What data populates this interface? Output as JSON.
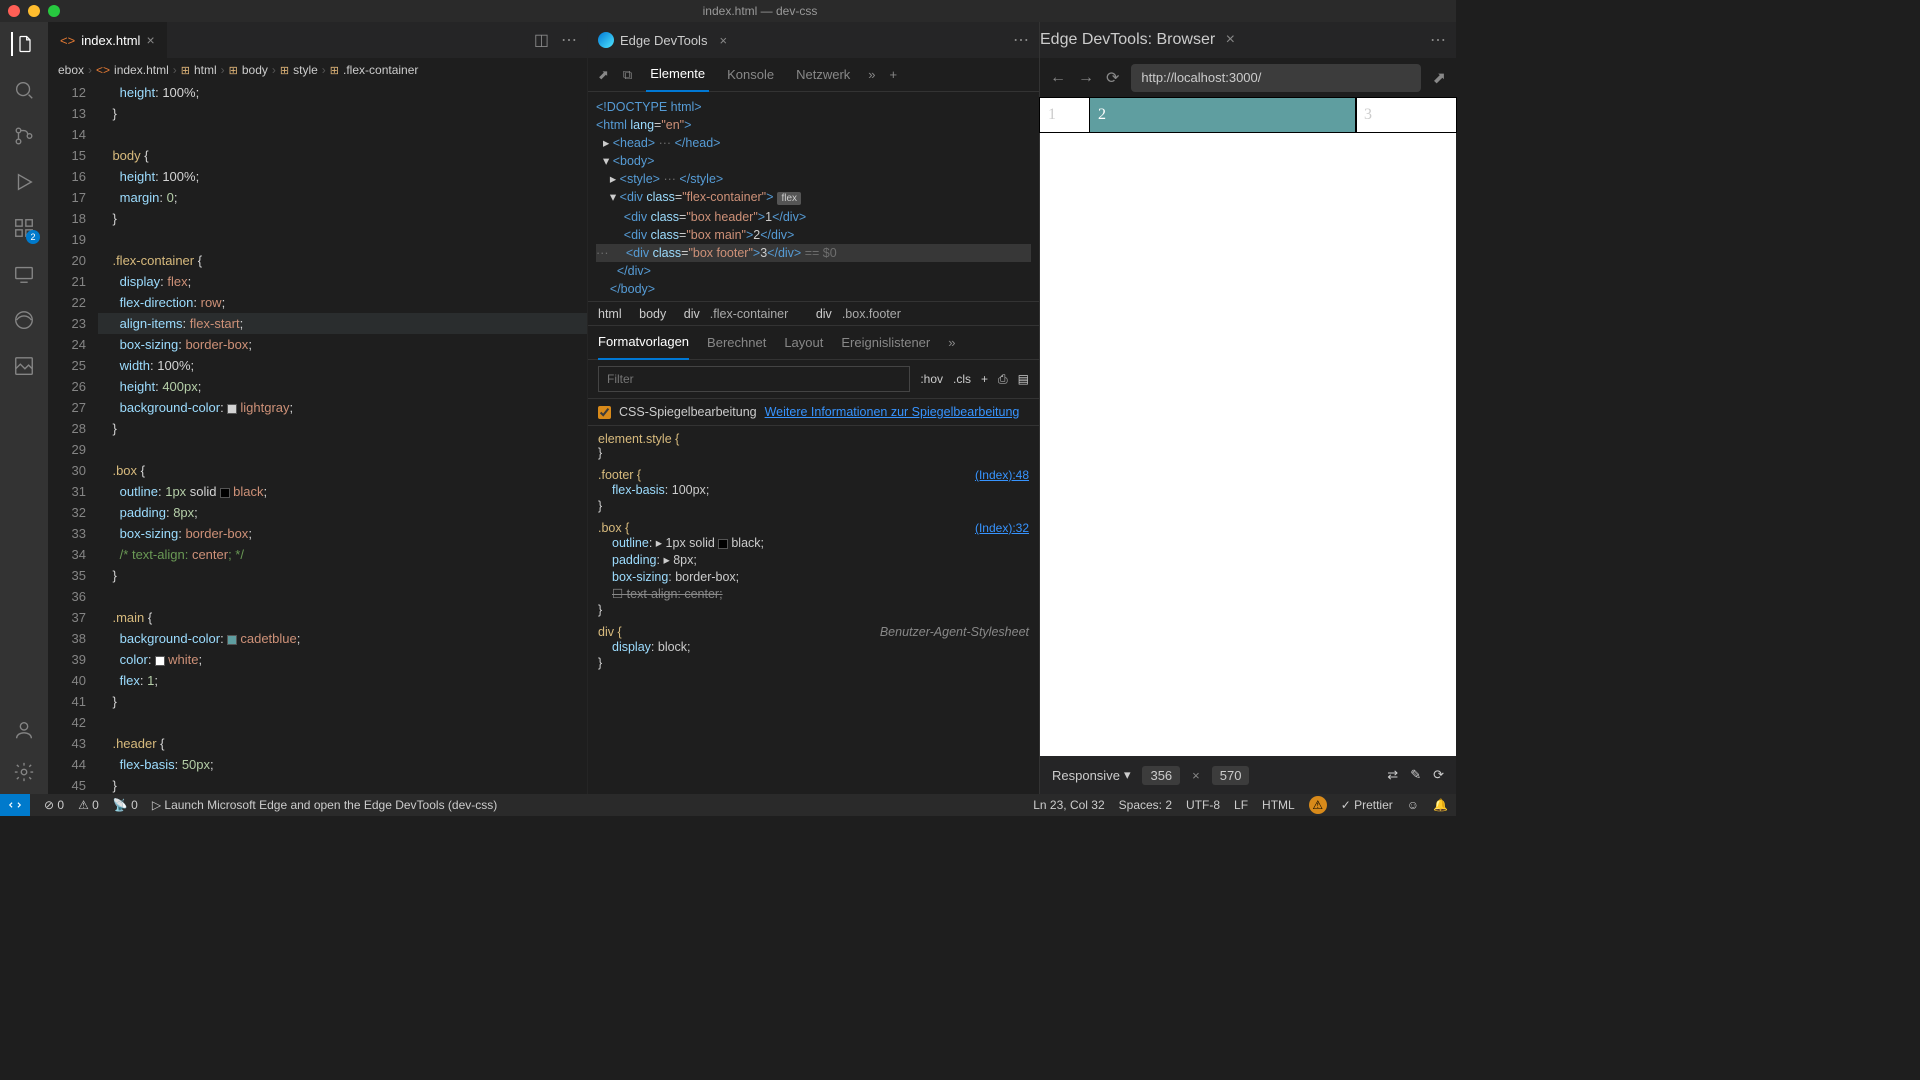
{
  "window": {
    "title": "index.html — dev-css"
  },
  "tabs": {
    "editor": {
      "label": "index.html"
    },
    "devtools": {
      "label": "Edge DevTools"
    },
    "browser": {
      "label": "Edge DevTools: Browser"
    }
  },
  "breadcrumb": [
    "ebox",
    "index.html",
    "html",
    "body",
    "style",
    ".flex-container"
  ],
  "editor": {
    "startLine": 12,
    "lines": [
      "      height: 100%;",
      "    }",
      "",
      "    body {",
      "      height: 100%;",
      "      margin: 0;",
      "    }",
      "",
      "    .flex-container {",
      "      display: flex;",
      "      flex-direction: row;",
      "      align-items: flex-start;",
      "      box-sizing: border-box;",
      "      width: 100%;",
      "      height: 400px;",
      "      background-color: lightgray;",
      "    }",
      "",
      "    .box {",
      "      outline: 1px solid black;",
      "      padding: 8px;",
      "      box-sizing: border-box;",
      "      /* text-align: center; */",
      "    }",
      "",
      "    .main {",
      "      background-color: cadetblue;",
      "      color: white;",
      "      flex: 1;",
      "    }",
      "",
      "    .header {",
      "      flex-basis: 50px;",
      "    }"
    ]
  },
  "devtools": {
    "toolbar": [
      "Elemente",
      "Konsole",
      "Netzwerk"
    ],
    "dom": {
      "doctype": "<!DOCTYPE html>",
      "htmlOpen": "<html lang=\"en\">",
      "head": "<head> ··· </head>",
      "bodyOpen": "<body>",
      "style": "<style> ··· </style>",
      "flexOpen": "<div class=\"flex-container\">",
      "box1": "<div class=\"box header\">1</div>",
      "box2": "<div class=\"box main\">2</div>",
      "box3": "<div class=\"box footer\">3</div>",
      "box3After": " == $0",
      "flexClose": "</div>",
      "bodyClose": "</body>"
    },
    "crumbs": [
      "html",
      "body",
      "div.flex-container",
      "div.box.footer"
    ],
    "stylesTabs": [
      "Formatvorlagen",
      "Berechnet",
      "Layout",
      "Ereignislistener"
    ],
    "filterPlaceholder": "Filter",
    "hov": ":hov",
    "cls": ".cls",
    "mirror": {
      "label": "CSS-Spiegelbearbeitung",
      "link": "Weitere Informationen zur Spiegelbearbeitung"
    },
    "rules": {
      "elementStyle": "element.style {",
      "footer": {
        "sel": ".footer {",
        "src": "(Index):48",
        "props": [
          "flex-basis: 100px;"
        ]
      },
      "box": {
        "sel": ".box {",
        "src": "(Index):32",
        "props": [
          "outline: ▸ 1px solid ■ black;",
          "padding: ▸ 8px;",
          "box-sizing: border-box;"
        ],
        "strike": "text-align: center;"
      },
      "div": {
        "sel": "div {",
        "ua": "Benutzer-Agent-Stylesheet",
        "props": [
          "display: block;"
        ]
      }
    }
  },
  "browser": {
    "url": "http://localhost:3000/",
    "cells": [
      "1",
      "2",
      "3"
    ],
    "responsive": "Responsive",
    "width": "356",
    "height": "570"
  },
  "status": {
    "errors": "0",
    "warnings": "0",
    "ports": "0",
    "launch": "Launch Microsoft Edge and open the Edge DevTools (dev-css)",
    "lncol": "Ln 23, Col 32",
    "spaces": "Spaces: 2",
    "encoding": "UTF-8",
    "eol": "LF",
    "lang": "HTML",
    "prettier": "Prettier"
  }
}
